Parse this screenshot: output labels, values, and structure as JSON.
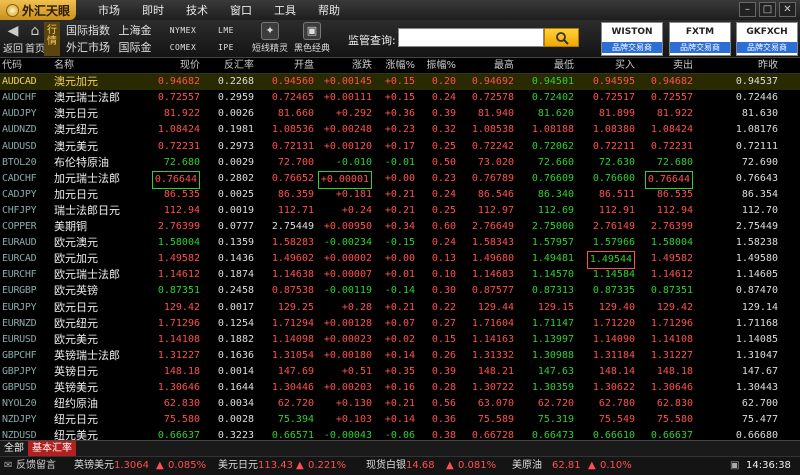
{
  "app": {
    "title": "外汇天眼"
  },
  "menu": [
    "市场",
    "即时",
    "技术",
    "窗口",
    "工具",
    "帮助"
  ],
  "toolbar": {
    "back": "返回",
    "home": "首页",
    "quote_tab": "行情",
    "markets": [
      "国际指数",
      "上海金",
      "NYMEX",
      "LME",
      "外汇市场",
      "国际金",
      "COMEX",
      "IPE"
    ],
    "genie": "短线精灵",
    "classic": "黑色经典",
    "search_label": "监管查询:",
    "search_value": "",
    "brands": [
      {
        "name": "WISTON",
        "sub": "品牌交易商"
      },
      {
        "name": "FXTM",
        "sub": "品牌交易商"
      },
      {
        "name": "GKFXCH",
        "sub": "品牌交易商"
      }
    ]
  },
  "table": {
    "headers": [
      "代码",
      "名称",
      "现价",
      "反汇率",
      "开盘",
      "涨跌",
      "涨幅%",
      "振幅%",
      "最高",
      "最低",
      "买入",
      "卖出",
      "昨收"
    ],
    "rows": [
      {
        "code": "AUDCAD",
        "name": "澳元加元",
        "price": "0.94682",
        "inv": "0.2268",
        "open": "0.94560",
        "chg": "+0.00145",
        "pct": "+0.15",
        "amp": "0.20",
        "high": "0.94692",
        "low": "0.94501",
        "bid": "0.94595",
        "ask": "0.94682",
        "prev": "0.94537"
      },
      {
        "code": "AUDCHF",
        "name": "澳元瑞士法郎",
        "price": "0.72557",
        "inv": "0.2959",
        "open": "0.72465",
        "chg": "+0.00111",
        "pct": "+0.15",
        "amp": "0.24",
        "high": "0.72578",
        "low": "0.72402",
        "bid": "0.72517",
        "ask": "0.72557",
        "prev": "0.72446"
      },
      {
        "code": "AUDJPY",
        "name": "澳元日元",
        "price": "81.922",
        "inv": "0.0026",
        "open": "81.660",
        "chg": "+0.292",
        "pct": "+0.36",
        "amp": "0.39",
        "high": "81.940",
        "low": "81.620",
        "bid": "81.899",
        "ask": "81.922",
        "prev": "81.630"
      },
      {
        "code": "AUDNZD",
        "name": "澳元纽元",
        "price": "1.08424",
        "inv": "0.1981",
        "open": "1.08536",
        "chg": "+0.00248",
        "pct": "+0.23",
        "amp": "0.32",
        "high": "1.08538",
        "low": "1.08188",
        "bid": "1.08380",
        "ask": "1.08424",
        "prev": "1.08176"
      },
      {
        "code": "AUDUSD",
        "name": "澳元美元",
        "price": "0.72231",
        "inv": "0.2973",
        "open": "0.72131",
        "chg": "+0.00120",
        "pct": "+0.17",
        "amp": "0.25",
        "high": "0.72242",
        "low": "0.72062",
        "bid": "0.72211",
        "ask": "0.72231",
        "prev": "0.72111"
      },
      {
        "code": "BTOL20",
        "name": "布伦特原油",
        "price": "72.680",
        "inv": "0.0029",
        "open": "72.700",
        "chg": "-0.010",
        "pct": "-0.01",
        "amp": "0.50",
        "high": "73.020",
        "low": "72.660",
        "bid": "72.630",
        "ask": "72.680",
        "prev": "72.690"
      },
      {
        "code": "CADCHF",
        "name": "加元瑞士法郎",
        "price": "0.76644",
        "inv": "0.2802",
        "open": "0.76652",
        "chg": "+0.00001",
        "pct": "+0.00",
        "amp": "0.23",
        "high": "0.76789",
        "low": "0.76609",
        "bid": "0.76600",
        "ask": "0.76644",
        "prev": "0.76643"
      },
      {
        "code": "CADJPY",
        "name": "加元日元",
        "price": "86.535",
        "inv": "0.0025",
        "open": "86.359",
        "chg": "+0.181",
        "pct": "+0.21",
        "amp": "0.24",
        "high": "86.546",
        "low": "86.340",
        "bid": "86.511",
        "ask": "86.535",
        "prev": "86.354"
      },
      {
        "code": "CHFJPY",
        "name": "瑞士法郎日元",
        "price": "112.94",
        "inv": "0.0019",
        "open": "112.71",
        "chg": "+0.24",
        "pct": "+0.21",
        "amp": "0.25",
        "high": "112.97",
        "low": "112.69",
        "bid": "112.91",
        "ask": "112.94",
        "prev": "112.70"
      },
      {
        "code": "COPPER",
        "name": "美期铜",
        "price": "2.76399",
        "inv": "0.0777",
        "open": "2.75449",
        "chg": "+0.00950",
        "pct": "+0.34",
        "amp": "0.60",
        "high": "2.76649",
        "low": "2.75000",
        "bid": "2.76149",
        "ask": "2.76399",
        "prev": "2.75449"
      },
      {
        "code": "EURAUD",
        "name": "欧元澳元",
        "price": "1.58004",
        "inv": "0.1359",
        "open": "1.58283",
        "chg": "-0.00234",
        "pct": "-0.15",
        "amp": "0.24",
        "high": "1.58343",
        "low": "1.57957",
        "bid": "1.57966",
        "ask": "1.58004",
        "prev": "1.58238"
      },
      {
        "code": "EURCAD",
        "name": "欧元加元",
        "price": "1.49582",
        "inv": "0.1436",
        "open": "1.49602",
        "chg": "+0.00002",
        "pct": "+0.00",
        "amp": "0.13",
        "high": "1.49680",
        "low": "1.49481",
        "bid": "1.49544",
        "ask": "1.49582",
        "prev": "1.49580"
      },
      {
        "code": "EURCHF",
        "name": "欧元瑞士法郎",
        "price": "1.14612",
        "inv": "0.1874",
        "open": "1.14638",
        "chg": "+0.00007",
        "pct": "+0.01",
        "amp": "0.10",
        "high": "1.14683",
        "low": "1.14570",
        "bid": "1.14584",
        "ask": "1.14612",
        "prev": "1.14605"
      },
      {
        "code": "EURGBP",
        "name": "欧元英镑",
        "price": "0.87351",
        "inv": "0.2458",
        "open": "0.87538",
        "chg": "-0.00119",
        "pct": "-0.14",
        "amp": "0.30",
        "high": "0.87577",
        "low": "0.87313",
        "bid": "0.87335",
        "ask": "0.87351",
        "prev": "0.87470"
      },
      {
        "code": "EURJPY",
        "name": "欧元日元",
        "price": "129.42",
        "inv": "0.0017",
        "open": "129.25",
        "chg": "+0.28",
        "pct": "+0.21",
        "amp": "0.22",
        "high": "129.44",
        "low": "129.15",
        "bid": "129.40",
        "ask": "129.42",
        "prev": "129.14"
      },
      {
        "code": "EURNZD",
        "name": "欧元纽元",
        "price": "1.71296",
        "inv": "0.1254",
        "open": "1.71294",
        "chg": "+0.00128",
        "pct": "+0.07",
        "amp": "0.27",
        "high": "1.71604",
        "low": "1.71147",
        "bid": "1.71220",
        "ask": "1.71296",
        "prev": "1.71168"
      },
      {
        "code": "EURUSD",
        "name": "欧元美元",
        "price": "1.14108",
        "inv": "0.1882",
        "open": "1.14098",
        "chg": "+0.00023",
        "pct": "+0.02",
        "amp": "0.15",
        "high": "1.14163",
        "low": "1.13997",
        "bid": "1.14090",
        "ask": "1.14108",
        "prev": "1.14085"
      },
      {
        "code": "GBPCHF",
        "name": "英镑瑞士法郎",
        "price": "1.31227",
        "inv": "0.1636",
        "open": "1.31054",
        "chg": "+0.00180",
        "pct": "+0.14",
        "amp": "0.26",
        "high": "1.31332",
        "low": "1.30988",
        "bid": "1.31184",
        "ask": "1.31227",
        "prev": "1.31047"
      },
      {
        "code": "GBPJPY",
        "name": "英镑日元",
        "price": "148.18",
        "inv": "0.0014",
        "open": "147.69",
        "chg": "+0.51",
        "pct": "+0.35",
        "amp": "0.39",
        "high": "148.21",
        "low": "147.63",
        "bid": "148.14",
        "ask": "148.18",
        "prev": "147.67"
      },
      {
        "code": "GBPUSD",
        "name": "英镑美元",
        "price": "1.30646",
        "inv": "0.1644",
        "open": "1.30446",
        "chg": "+0.00203",
        "pct": "+0.16",
        "amp": "0.28",
        "high": "1.30722",
        "low": "1.30359",
        "bid": "1.30622",
        "ask": "1.30646",
        "prev": "1.30443"
      },
      {
        "code": "NYOL20",
        "name": "纽约原油",
        "price": "62.830",
        "inv": "0.0034",
        "open": "62.720",
        "chg": "+0.130",
        "pct": "+0.21",
        "amp": "0.56",
        "high": "63.070",
        "low": "62.720",
        "bid": "62.780",
        "ask": "62.830",
        "prev": "62.700"
      },
      {
        "code": "NZDJPY",
        "name": "纽元日元",
        "price": "75.580",
        "inv": "0.0028",
        "open": "75.394",
        "chg": "+0.103",
        "pct": "+0.14",
        "amp": "0.36",
        "high": "75.589",
        "low": "75.319",
        "bid": "75.549",
        "ask": "75.580",
        "prev": "75.477"
      },
      {
        "code": "NZDUSD",
        "name": "纽元美元",
        "price": "0.66637",
        "inv": "0.3223",
        "open": "0.66571",
        "chg": "-0.00043",
        "pct": "-0.06",
        "amp": "0.38",
        "high": "0.66728",
        "low": "0.66473",
        "bid": "0.66610",
        "ask": "0.66637",
        "prev": "0.66680"
      }
    ]
  },
  "bottom_tabs": [
    "全部",
    "基本汇率"
  ],
  "status": {
    "tip": "反馈留言",
    "tickers": [
      {
        "name": "英镑美元",
        "value": "1.3064",
        "pct": "0.085%"
      },
      {
        "name": "美元日元",
        "value": "113.43",
        "pct": "0.221%"
      },
      {
        "name": "现货白银",
        "value": "14.68",
        "pct": "0.081%"
      },
      {
        "name": "美原油",
        "value": "62.81",
        "pct": "0.10%"
      }
    ],
    "time": "14:36:38"
  },
  "colors": {
    "up": "#ff5050",
    "down": "#30d030",
    "neutral": "#dddddd",
    "header": "#c8c8c8",
    "accent": "#f0b020"
  }
}
